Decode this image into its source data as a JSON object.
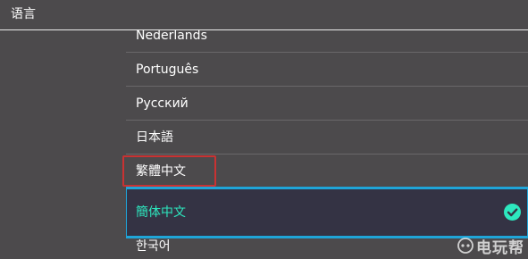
{
  "header": {
    "title": "语言"
  },
  "languages": [
    {
      "label": "Nederlands",
      "selected": false
    },
    {
      "label": "Português",
      "selected": false
    },
    {
      "label": "Русский",
      "selected": false
    },
    {
      "label": "日本語",
      "selected": false
    },
    {
      "label": "繁體中文",
      "selected": false,
      "highlighted": true
    },
    {
      "label": "簡体中文",
      "selected": true
    },
    {
      "label": "한국어",
      "selected": false
    }
  ],
  "selection": {
    "icon": "check-circle-icon",
    "accent_color": "#2de8bf",
    "border_color": "#1fa5d8"
  },
  "highlight": {
    "color": "#c93232"
  },
  "watermark": {
    "text": "电玩帮",
    "icon": "gamepad-logo-icon"
  }
}
